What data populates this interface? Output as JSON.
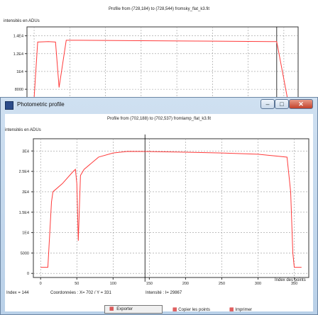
{
  "window_back": {
    "plot_title": "Profile from (728,184) to (728,544) fromsky_flat_k3.fit",
    "ylabel": "intensités en ADUs",
    "ytick_labels": [
      "1.4E4",
      "1.2E4",
      "1E4",
      "8000"
    ]
  },
  "window_front": {
    "title": "Photometric profile",
    "controls": {
      "minimize": "–",
      "maximize": "□",
      "close": "✕"
    },
    "plot_title": "Profile from (702,188) to (702,537) fromlamp_flat_k3.fit",
    "ylabel": "intensités en ADUs",
    "xlabel": "Index des points",
    "ytick_labels": [
      "3E4",
      "2.5E4",
      "2E4",
      "1.5E4",
      "1E4",
      "5000",
      "0"
    ],
    "xtick_labels": [
      "0",
      "50",
      "100",
      "150",
      "200",
      "250",
      "300",
      "350"
    ],
    "status": {
      "index": "Index = 144",
      "coords": "Coordonnées : X= 702 / Y = 331",
      "intensity": "Intensité : I= 29867"
    }
  },
  "colors": {
    "profile_line": "#ff3b3b",
    "cursor": "#000000",
    "grid": "#999999"
  },
  "chart_data": [
    {
      "type": "line",
      "title": "Profile from (728,184) to (728,544) fromsky_flat_k3.fit",
      "ylabel": "intensités en ADUs",
      "yticks": [
        "1.4E4",
        "1.2E4",
        "1E4",
        "8000"
      ],
      "series": [
        {
          "x": [
            0,
            5,
            20,
            30,
            35,
            45,
            60,
            150,
            250,
            340,
            355,
            360
          ],
          "y": [
            7000,
            13300,
            13350,
            13300,
            8200,
            13500,
            13500,
            13450,
            13400,
            13350,
            7000,
            7000
          ]
        }
      ]
    },
    {
      "type": "line",
      "title": "Profile from (702,188) to (702,537) fromlamp_flat_k3.fit",
      "ylabel": "intensités en ADUs",
      "xlabel": "Index des points",
      "xlim": [
        -10,
        370
      ],
      "ylim": [
        -1000,
        33000
      ],
      "grid": true,
      "cursor_index": 144,
      "series": [
        {
          "x": [
            0,
            10,
            15,
            17,
            30,
            45,
            48,
            50,
            52,
            55,
            60,
            80,
            100,
            120,
            144,
            200,
            250,
            300,
            340,
            345,
            348,
            350,
            360
          ],
          "y": [
            1500,
            1500,
            17500,
            20000,
            22000,
            25000,
            25500,
            22000,
            8000,
            24000,
            25500,
            28500,
            29500,
            29900,
            29867,
            29700,
            29500,
            29200,
            28500,
            20000,
            5000,
            1500,
            1500
          ]
        }
      ]
    }
  ],
  "buttons": [
    {
      "icon": "chart-icon",
      "label": "Exporter"
    },
    {
      "icon": "chart-icon",
      "label": "Copier les points"
    },
    {
      "icon": "chart-icon",
      "label": "Imprimer"
    }
  ]
}
